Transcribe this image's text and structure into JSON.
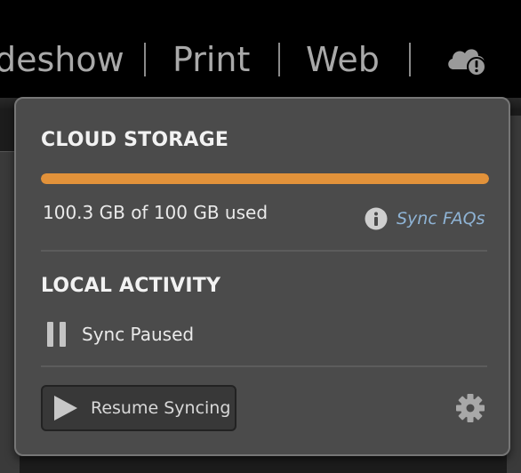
{
  "header": {
    "modules": [
      {
        "label": "deshow"
      },
      {
        "label": "Print"
      },
      {
        "label": "Web"
      }
    ],
    "cloud_status_icon": "cloud-warning-icon"
  },
  "popover": {
    "cloud_storage": {
      "title": "CLOUD STORAGE",
      "used_fraction": 1.0,
      "bar_color": "#e2923a",
      "usage_text": "100.3 GB of 100 GB used",
      "faq_link": "Sync FAQs",
      "faq_icon": "info-icon"
    },
    "local_activity": {
      "title": "LOCAL ACTIVITY",
      "status_text": "Sync Paused",
      "status_icon": "pause-icon"
    },
    "actions": {
      "resume_label": "Resume Syncing",
      "resume_icon": "play-icon",
      "settings_icon": "gear-icon"
    }
  },
  "colors": {
    "accent_storage": "#e2923a",
    "link": "#8fb4d6",
    "panel_bg": "#4b4b4b"
  }
}
